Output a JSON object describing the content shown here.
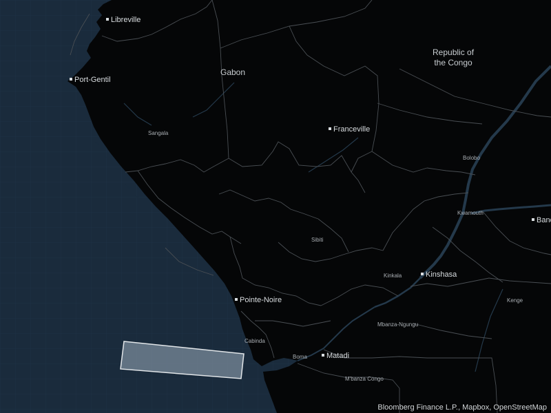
{
  "map": {
    "theme": "dark",
    "colors": {
      "ocean": "#1a2b3c",
      "land": "#050607",
      "border": "#4a4f54",
      "river": "#24394b",
      "label": "#d9dde0",
      "highlight_fill": "#7d8e9e",
      "highlight_stroke": "#e2e6e9"
    },
    "countries": {
      "gabon": "Gabon",
      "congo_line1": "Republic of",
      "congo_line2": "the Congo"
    },
    "cities": {
      "libreville": "Libreville",
      "port_gentil": "Port-Gentil",
      "sangala": "Sangala",
      "franceville": "Franceville",
      "bolobo": "Bolobo",
      "kwamouth": "Kwamouth",
      "bandundu": "Band",
      "sibiti": "Sibiti",
      "kinkala": "Kinkala",
      "kinshasa": "Kinshasa",
      "kenge": "Kenge",
      "pointe_noire": "Pointe-Noire",
      "mbanza_ngungu": "Mbanza-Ngungu",
      "cabinda": "Cabinda",
      "boma": "Boma",
      "matadi": "Matadi",
      "mbanza_congo": "M'banza Congo"
    },
    "attribution": "Bloomberg Finance L.P., Mapbox, OpenStreetMap"
  }
}
